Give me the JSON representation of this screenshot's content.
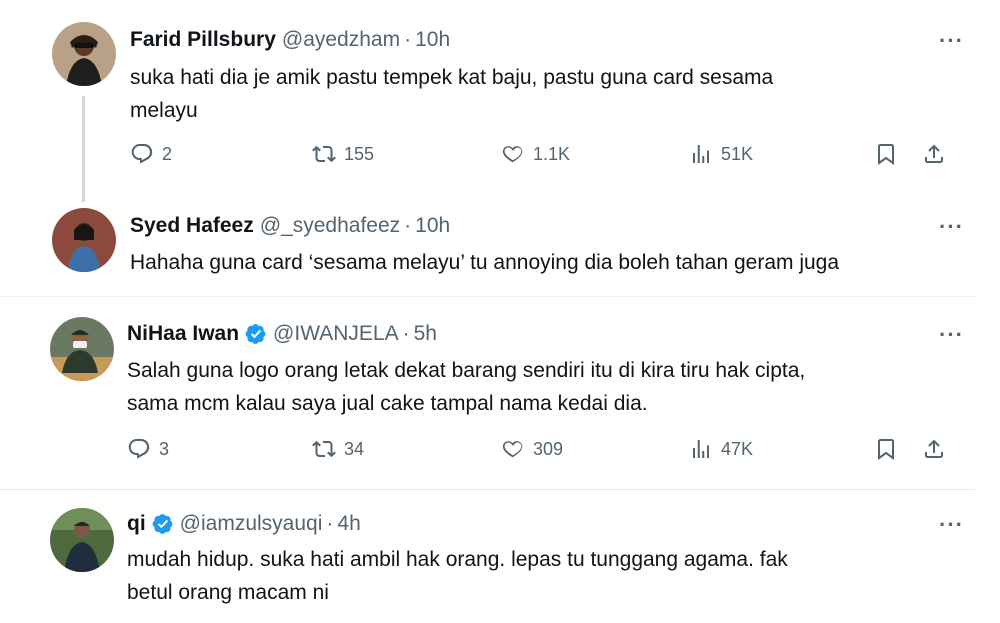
{
  "tweets": [
    {
      "name": "Farid Pillsbury",
      "handle": "@ayedzham",
      "time": "10h",
      "verified": false,
      "lines": [
        "suka hati dia je amik pastu tempek kat baju, pastu guna card sesama",
        "melayu"
      ],
      "replies": "2",
      "retweets": "155",
      "likes": "1.1K",
      "views": "51K"
    },
    {
      "name": "Syed Hafeez",
      "handle": "@_syedhafeez",
      "time": "10h",
      "verified": false,
      "lines": [
        "Hahaha guna card ‘sesama melayu’ tu annoying dia boleh tahan geram juga"
      ]
    },
    {
      "name": "NiHaa Iwan",
      "handle": "@IWANJELA",
      "time": "5h",
      "verified": true,
      "lines": [
        "Salah guna logo orang letak dekat barang sendiri itu di kira tiru hak cipta,",
        "sama mcm kalau saya jual cake tampal nama kedai dia."
      ],
      "replies": "3",
      "retweets": "34",
      "likes": "309",
      "views": "47K"
    },
    {
      "name": "qi",
      "handle": "@iamzulsyauqi",
      "time": "4h",
      "verified": true,
      "lines": [
        "mudah hidup. suka hati ambil hak orang. lepas tu tunggang agama. fak",
        "betul orang macam ni"
      ]
    }
  ],
  "ui": {
    "dot": "·",
    "more": "···"
  },
  "colors": {
    "text": "#0f1419",
    "secondary": "#536471",
    "verified": "#1d9bf0",
    "divider": "#e6ecf0"
  },
  "icons": [
    "reply-icon",
    "retweet-icon",
    "like-icon",
    "views-icon",
    "bookmark-icon",
    "share-icon",
    "verified-badge-icon",
    "more-icon"
  ]
}
